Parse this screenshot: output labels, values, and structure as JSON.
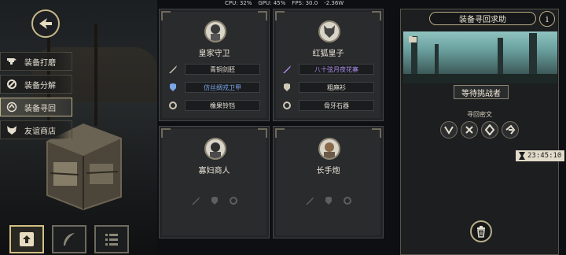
{
  "status_bar": {
    "cpu": "CPU: 32%",
    "gpu": "GPU: 45%",
    "fps": "FPS: 30.0",
    "power": "-2.36W"
  },
  "menu": {
    "items": [
      {
        "label": "装备打磨",
        "icon": "anvil-icon",
        "active": false
      },
      {
        "label": "装备分解",
        "icon": "gear-break-icon",
        "active": false
      },
      {
        "label": "装备寻回",
        "icon": "reclaim-icon",
        "active": true
      },
      {
        "label": "友谊商店",
        "icon": "fox-icon",
        "active": false
      }
    ]
  },
  "bottom_buttons": [
    {
      "icon": "upload-icon",
      "active": true
    },
    {
      "icon": "feather-icon",
      "active": false
    },
    {
      "icon": "list-icon",
      "active": false
    }
  ],
  "cards": [
    {
      "name": "皇家守卫",
      "portrait": "royal-guard-portrait",
      "equipment": [
        {
          "name": "青铜剑胚",
          "rarity": "common",
          "icon": "sword-icon"
        },
        {
          "name": "仿丝绸戎卫甲",
          "rarity": "rare",
          "icon": "armor-icon"
        },
        {
          "name": "橡果铃铛",
          "rarity": "common",
          "icon": "ring-icon"
        }
      ]
    },
    {
      "name": "红狐皇子",
      "portrait": "red-fox-prince-portrait",
      "equipment": [
        {
          "name": "八十弦月夜花寨",
          "rarity": "epic",
          "icon": "sword-icon"
        },
        {
          "name": "粗麻衫",
          "rarity": "common",
          "icon": "armor-icon"
        },
        {
          "name": "骨牙石器",
          "rarity": "common",
          "icon": "ring-icon"
        }
      ]
    },
    {
      "name": "寡妇商人",
      "portrait": "widow-merchant-portrait",
      "equipment": []
    },
    {
      "name": "长手炮",
      "portrait": "long-cannon-portrait",
      "equipment": []
    }
  ],
  "right_panel": {
    "title": "装备寻回求助",
    "info": "i",
    "banner_label": "等待挑战者",
    "sub_label": "寻回密文",
    "runes": [
      "rune-v-icon",
      "rune-x-icon",
      "rune-diamond-icon",
      "rune-swirl-icon"
    ],
    "timer": "23:45:10"
  },
  "colors": {
    "accent": "#c9b98a",
    "rare": "#78a6e6",
    "epic": "#a98be8",
    "panel": "#2a2b2d"
  }
}
